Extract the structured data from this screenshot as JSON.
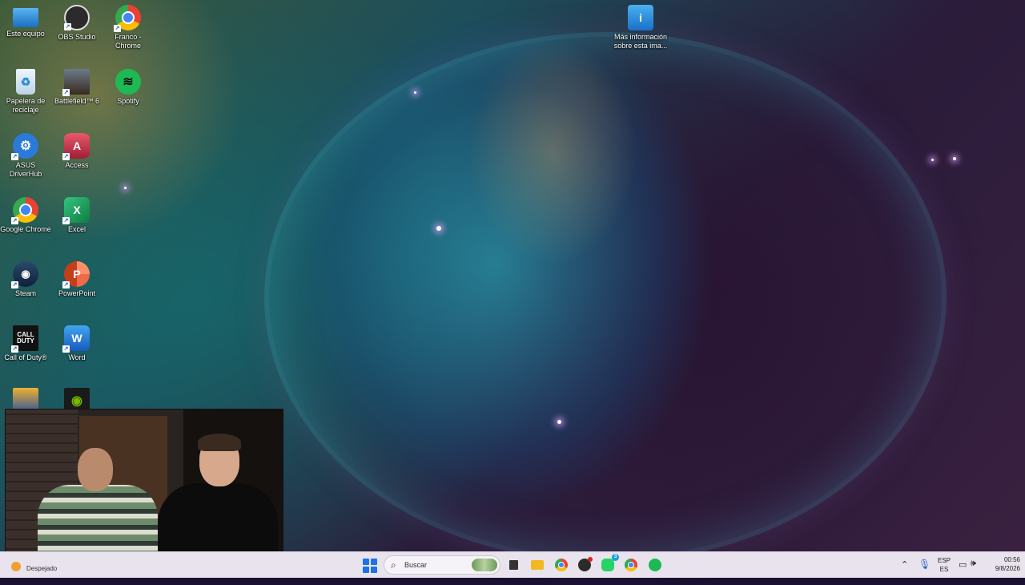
{
  "desktop": {
    "icons": [
      {
        "label": "Este equipo",
        "icon": "computer-icon",
        "color": "#3aa0e8"
      },
      {
        "label": "OBS Studio",
        "icon": "obs-icon",
        "color": "#2b2b2b"
      },
      {
        "label": "Franco - Chrome",
        "icon": "chrome-profile-icon",
        "color": "#e94235"
      },
      {
        "label": "Papelera de reciclaje",
        "icon": "recycle-bin-icon",
        "color": "#d8e8f4"
      },
      {
        "label": "Battlefield™ 6",
        "icon": "battlefield-icon",
        "color": "#5a4a3a"
      },
      {
        "label": "Spotify",
        "icon": "spotify-icon",
        "color": "#1db954"
      },
      {
        "label": "ASUS DriverHub",
        "icon": "asus-driverhub-icon",
        "color": "#2a7ad8"
      },
      {
        "label": "Access",
        "icon": "access-icon",
        "color": "#c0334a"
      },
      {
        "label": "Google Chrome",
        "icon": "chrome-icon",
        "color": "#e94235"
      },
      {
        "label": "Excel",
        "icon": "excel-icon",
        "color": "#1d7044"
      },
      {
        "label": "Steam",
        "icon": "steam-icon",
        "color": "#1b2838"
      },
      {
        "label": "PowerPoint",
        "icon": "powerpoint-icon",
        "color": "#d35230"
      },
      {
        "label": "Call of Duty®",
        "icon": "call-of-duty-icon",
        "color": "#111111"
      },
      {
        "label": "Word",
        "icon": "word-icon",
        "color": "#2b64c8"
      },
      {
        "label": "",
        "icon": "counter-strike-icon",
        "color": "#e8a21a"
      },
      {
        "label": "",
        "icon": "nvidia-icon",
        "color": "#76b900"
      }
    ],
    "spotlight": {
      "label": "Más información sobre esta ima...",
      "icon": "spotlight-info-icon"
    }
  },
  "taskbar": {
    "weather_text": "Despejado",
    "search_placeholder": "Buscar",
    "apps": [
      {
        "name": "task-view",
        "icon": "task-view-icon",
        "color": "#333333"
      },
      {
        "name": "file-explorer",
        "icon": "file-explorer-icon",
        "color": "#f2b824"
      },
      {
        "name": "chrome",
        "icon": "chrome-icon",
        "color": "#e94235"
      },
      {
        "name": "obs",
        "icon": "obs-icon",
        "color": "#2b2b2b"
      },
      {
        "name": "whatsapp",
        "icon": "whatsapp-icon",
        "color": "#25d366",
        "badge": "3"
      },
      {
        "name": "chrome-profile",
        "icon": "chrome-profile-icon",
        "color": "#4285f4"
      },
      {
        "name": "spotify",
        "icon": "spotify-icon",
        "color": "#1db954"
      }
    ],
    "lang_top": "ESP",
    "lang_bottom": "ES",
    "time": "00:56",
    "date": "9/8/2026"
  }
}
